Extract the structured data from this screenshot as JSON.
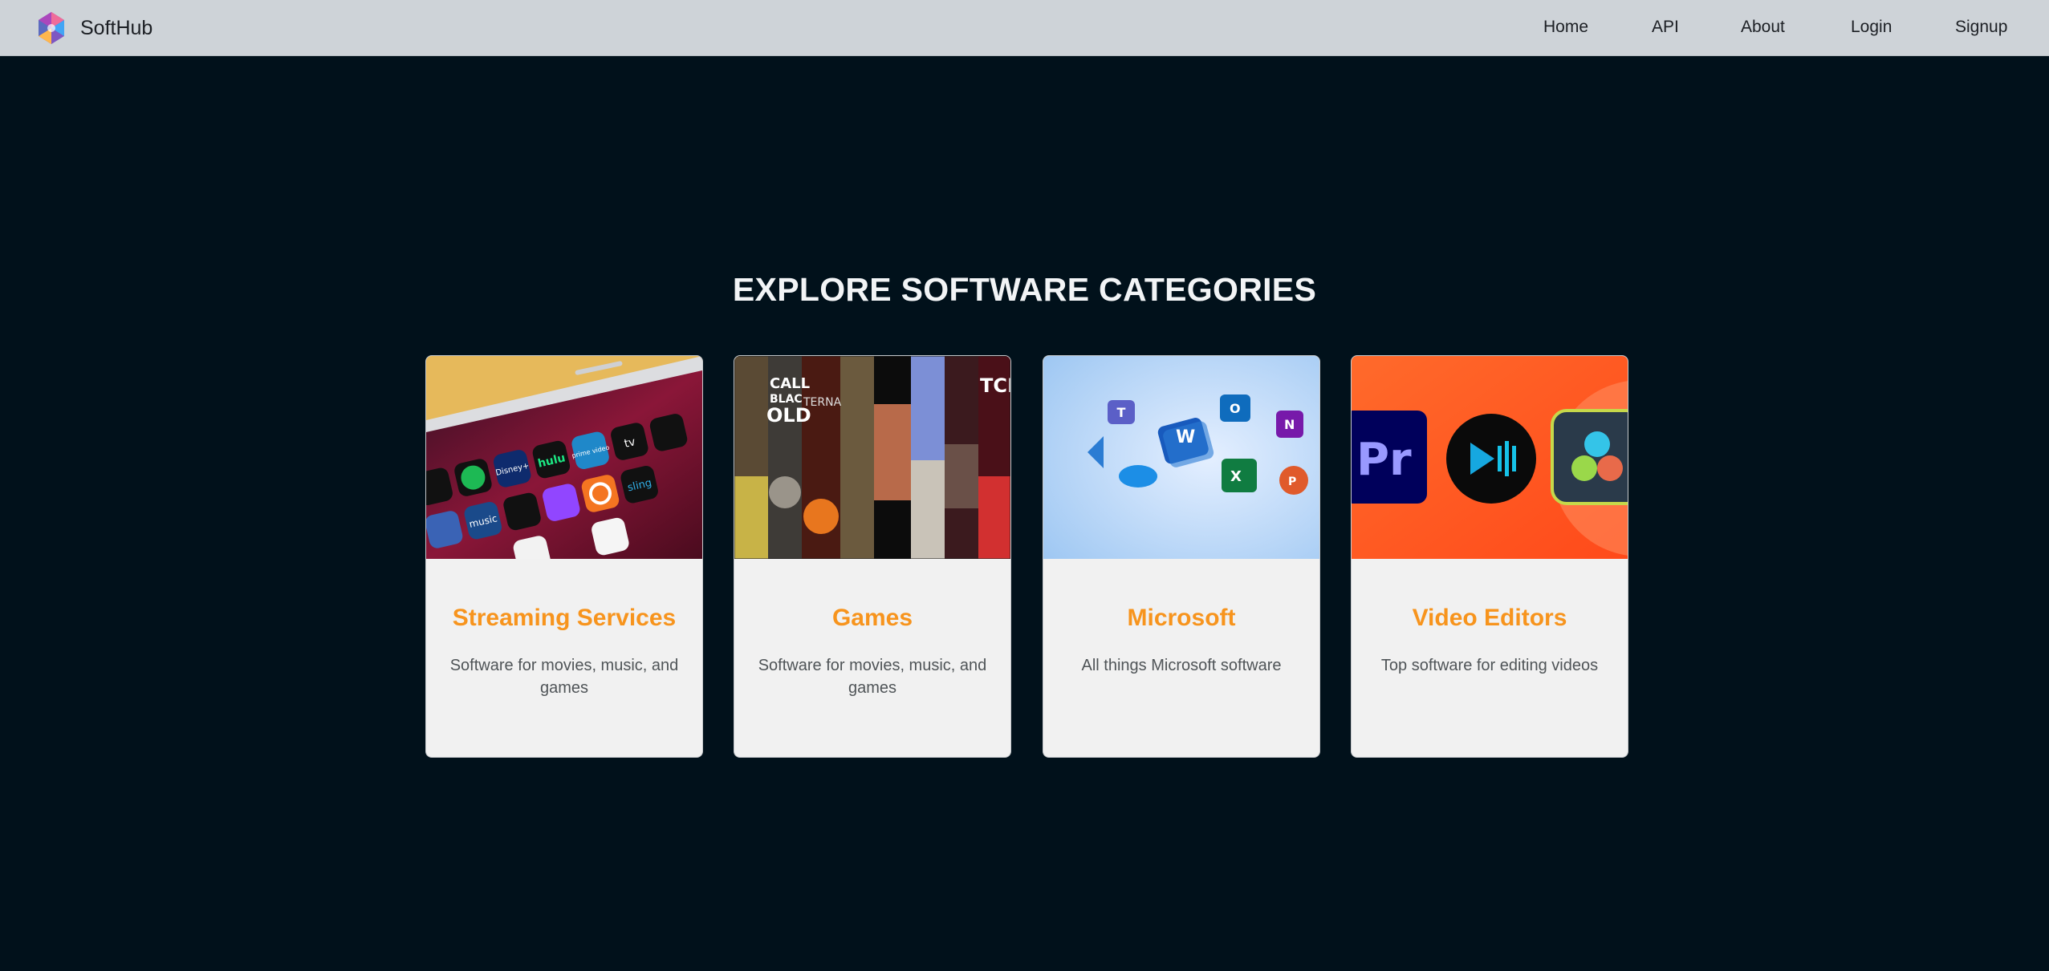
{
  "navbar": {
    "brand": "SoftHub",
    "links": [
      "Home",
      "API",
      "About",
      "Login",
      "Signup"
    ]
  },
  "page": {
    "heading": "EXPLORE SOFTWARE CATEGORIES"
  },
  "categories": [
    {
      "title": "Streaming Services",
      "description": "Software for movies, music, and games",
      "image_labels": [
        "prime video",
        "tv",
        "hulu",
        "Disney+",
        "sling",
        "music"
      ]
    },
    {
      "title": "Games",
      "description": "Software for movies, music, and games",
      "image_labels": [
        "CALL",
        "BLAC",
        "OLD",
        "TERNA",
        "TCI"
      ]
    },
    {
      "title": "Microsoft",
      "description": "All things Microsoft software",
      "image_labels": [
        "T",
        "W",
        "O",
        "N",
        "X",
        "P"
      ]
    },
    {
      "title": "Video Editors",
      "description": "Top software for editing videos",
      "image_labels": [
        "Pr"
      ]
    }
  ],
  "colors": {
    "background": "#01111b",
    "navbar": "#ced3d8",
    "card_title": "#f7941d",
    "card_bg": "#f1f1f1"
  }
}
